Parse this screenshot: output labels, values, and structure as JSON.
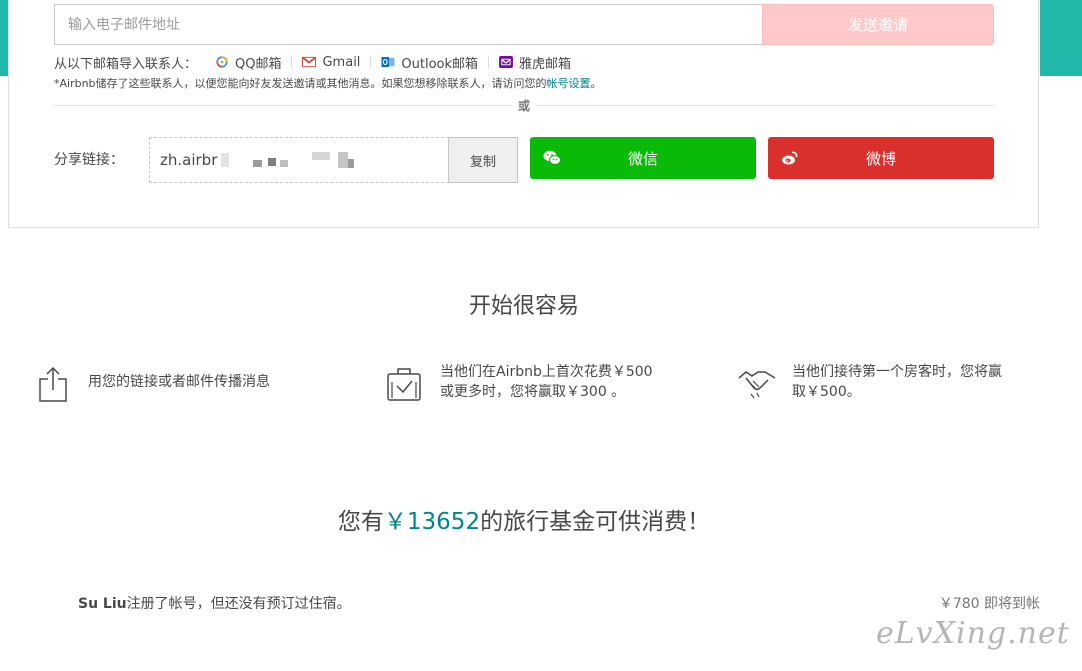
{
  "invite": {
    "email_placeholder": "输入电子邮件地址",
    "send_label": "发送邀请",
    "import_label": "从以下邮箱导入联系人：",
    "providers": [
      {
        "name": "QQ邮箱",
        "icon": "qq-mail-icon"
      },
      {
        "name": "Gmail",
        "icon": "gmail-icon"
      },
      {
        "name": "Outlook邮箱",
        "icon": "outlook-icon"
      },
      {
        "name": "雅虎邮箱",
        "icon": "yahoo-mail-icon"
      }
    ],
    "note_prefix": "*Airbnb储存了这些联系人，以便您能向好友发送邀请或其他消息。如果您想移除联系人，请访问您的",
    "note_link": "帐号设置",
    "note_suffix": "。",
    "or_label": "或"
  },
  "share": {
    "label": "分享链接：",
    "link_visible": "zh.airbr",
    "copy_label": "复制",
    "wechat_label": "微信",
    "weibo_label": "微博"
  },
  "how": {
    "title": "开始很容易",
    "steps": [
      {
        "icon": "share-icon",
        "text": "用您的链接或者邮件传播消息"
      },
      {
        "icon": "suitcase-check-icon",
        "text": "当他们在Airbnb上首次花费￥500或更多时，您将赢取￥300 。"
      },
      {
        "icon": "handshake-icon",
        "text": "当他们接待第一个房客时，您将赢取￥500。"
      }
    ]
  },
  "credit": {
    "prefix": "您有",
    "amount": "￥13652",
    "suffix": "的旅行基金可供消费！"
  },
  "referral": {
    "name": "Su Liu",
    "status": "注册了帐号，但还没有预订过住宿。",
    "reward": "￥780 即将到帐"
  },
  "watermark": "eLvXing.net",
  "colors": {
    "teal": "#1fb8a9",
    "link": "#008489",
    "send_disabled": "#ffc9c9",
    "wechat": "#09bb07",
    "weibo": "#d9302d"
  }
}
